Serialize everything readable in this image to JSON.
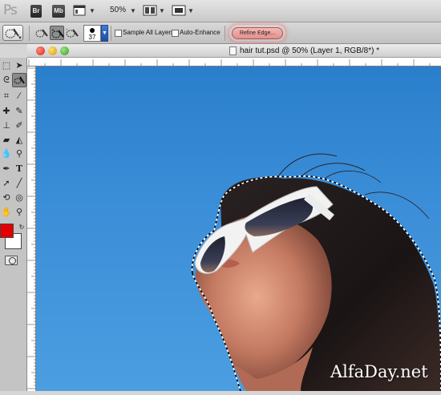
{
  "app_bar": {
    "logo": "Ps",
    "bridge_label": "Br",
    "minibridge_label": "Mb",
    "zoom": "50%"
  },
  "options_bar": {
    "brush_size": "37",
    "sample_all_layers_label": "Sample All Layers",
    "auto_enhance_label": "Auto-Enhance",
    "refine_edge_label": "Refine Edge..."
  },
  "document": {
    "title": "hair tut.psd @ 50% (Layer 1, RGB/8*) *"
  },
  "colors": {
    "foreground": "#e40000",
    "background": "#ffffff",
    "sky": "#3a8dd7"
  },
  "watermark": "AlfaDay.net",
  "icons": [
    "move-icon",
    "lasso-icon",
    "quick-selection-icon",
    "crop-icon",
    "eyedropper-icon",
    "healing-brush-icon",
    "brush-icon",
    "clone-stamp-icon",
    "history-brush-icon",
    "eraser-icon",
    "gradient-icon",
    "blur-icon",
    "dodge-icon",
    "pen-icon",
    "type-icon",
    "path-selection-icon",
    "shape-icon",
    "3d-rotate-icon",
    "hand-icon",
    "zoom-icon"
  ]
}
